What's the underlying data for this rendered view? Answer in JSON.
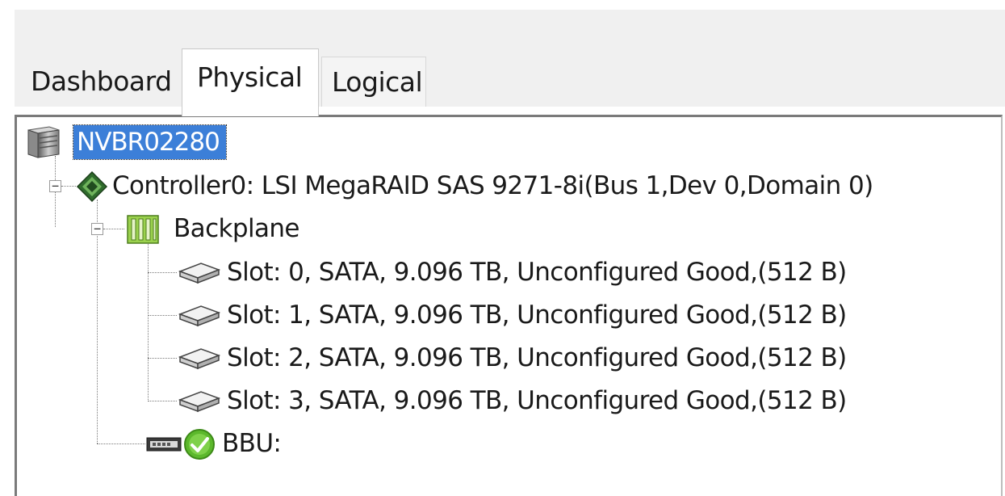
{
  "tabs": [
    {
      "label": "Dashboard",
      "selected": false
    },
    {
      "label": "Physical",
      "selected": true
    },
    {
      "label": "Logical",
      "selected": false
    }
  ],
  "tree": {
    "server": {
      "label": "NVBR02280",
      "icon": "server-icon",
      "selected": true
    },
    "controller": {
      "label": "Controller0: LSI MegaRAID SAS 9271-8i(Bus 1,Dev 0,Domain 0)",
      "icon": "controller-chip-icon",
      "expanded": true
    },
    "backplane": {
      "label": "Backplane",
      "icon": "backplane-icon",
      "expanded": true
    },
    "slots": [
      {
        "label": "Slot: 0, SATA, 9.096 TB, Unconfigured Good,(512 B)",
        "icon": "hard-drive-icon"
      },
      {
        "label": "Slot: 1, SATA, 9.096 TB, Unconfigured Good,(512 B)",
        "icon": "hard-drive-icon"
      },
      {
        "label": "Slot: 2, SATA, 9.096 TB, Unconfigured Good,(512 B)",
        "icon": "hard-drive-icon"
      },
      {
        "label": "Slot: 3, SATA, 9.096 TB, Unconfigured Good,(512 B)",
        "icon": "hard-drive-icon"
      }
    ],
    "bbu": {
      "label": "BBU:",
      "icons": [
        "battery-icon",
        "status-ok-icon"
      ]
    }
  },
  "colors": {
    "selection": "#3c7fd8",
    "status_ok": "#5cb82c",
    "backplane": "#8cc63f",
    "controller": "#3d7f3a"
  }
}
